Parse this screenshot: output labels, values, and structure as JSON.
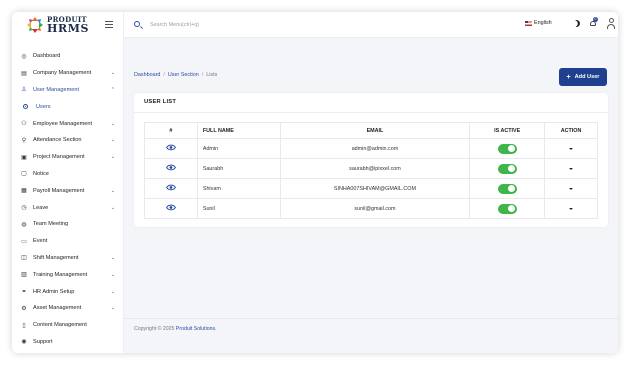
{
  "brand": {
    "top": "PRODUIT",
    "bottom": "HRMS"
  },
  "search": {
    "placeholder": "Search Menu(ctrl+q)"
  },
  "topbar": {
    "language": "English",
    "notification_count": "0"
  },
  "sidebar": {
    "items": [
      {
        "label": "Dashboard",
        "icon": "dashboard-icon"
      },
      {
        "label": "Company Management",
        "icon": "building-icon"
      },
      {
        "label": "User Management",
        "icon": "user-icon"
      },
      {
        "label": "Users",
        "icon": "dot-icon"
      },
      {
        "label": "Employee Management",
        "icon": "users-icon"
      },
      {
        "label": "Attendance Section",
        "icon": "user-check-icon"
      },
      {
        "label": "Project Management",
        "icon": "clipboard-icon"
      },
      {
        "label": "Notice",
        "icon": "file-icon"
      },
      {
        "label": "Payroll Management",
        "icon": "calculator-icon"
      },
      {
        "label": "Leave",
        "icon": "clock-icon"
      },
      {
        "label": "Team Meeting",
        "icon": "globe-icon"
      },
      {
        "label": "Event",
        "icon": "calendar-icon"
      },
      {
        "label": "Shift Management",
        "icon": "watch-icon"
      },
      {
        "label": "Training Management",
        "icon": "chart-icon"
      },
      {
        "label": "HR Admin Setup",
        "icon": "settings-icon"
      },
      {
        "label": "Asset Management",
        "icon": "gear-icon"
      },
      {
        "label": "Content Management",
        "icon": "document-icon"
      },
      {
        "label": "Support",
        "icon": "support-icon"
      }
    ]
  },
  "breadcrumb": {
    "dashboard": "Dashboard",
    "section": "User Section",
    "current": "Lists"
  },
  "actions": {
    "add_user": "Add User"
  },
  "card": {
    "title": "USER LIST"
  },
  "table": {
    "headers": {
      "num": "#",
      "full_name": "FULL NAME",
      "email": "EMAIL",
      "is_active": "IS ACTIVE",
      "action": "ACTION"
    },
    "rows": [
      {
        "full_name": "Admin",
        "email": "admin@admin.com",
        "is_active": true
      },
      {
        "full_name": "Saurabh",
        "email": "saurabh@ipixxel.com",
        "is_active": true
      },
      {
        "full_name": "Shivam",
        "email": "SINHA007SHIVAM@GMAIL.COM",
        "is_active": true
      },
      {
        "full_name": "Sunil",
        "email": "sunil@gmail.com",
        "is_active": true
      }
    ]
  },
  "footer": {
    "text": "Copyright © 2025",
    "brand": "Produit Solutions."
  },
  "colors": {
    "primary": "#1f3f8f",
    "toggle_on": "#3fb54a",
    "accent": "#2a4ba0"
  }
}
